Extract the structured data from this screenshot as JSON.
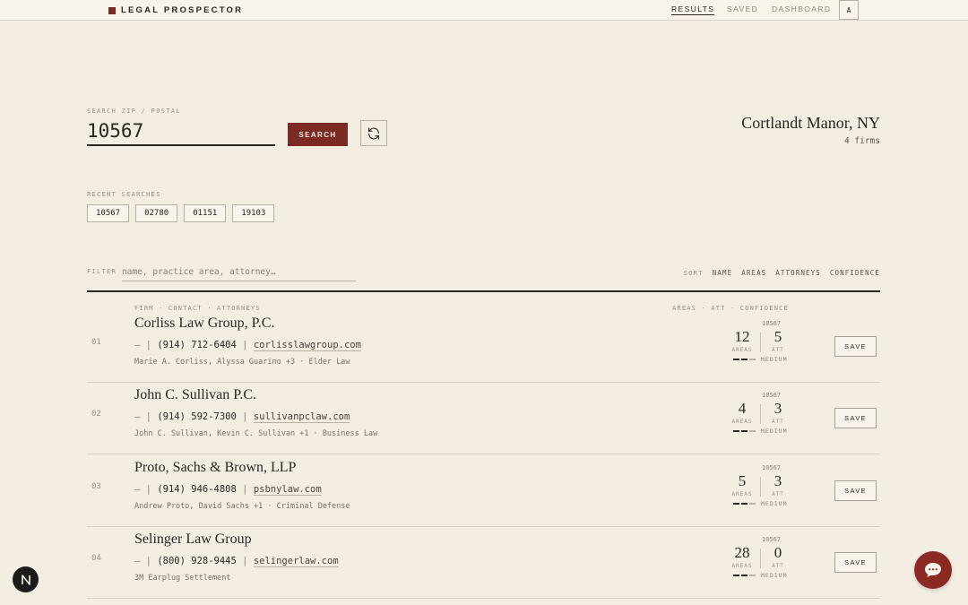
{
  "brand": {
    "name": "LEGAL PROSPECTOR",
    "accent": "#7a2a22"
  },
  "nav": [
    {
      "label": "RESULTS",
      "active": true
    },
    {
      "label": "SAVED",
      "active": false
    },
    {
      "label": "DASHBOARD",
      "active": false
    }
  ],
  "avatar": {
    "initial": "A"
  },
  "search": {
    "label": "SEARCH ZIP / POSTAL",
    "value": "10567",
    "button_label": "SEARCH",
    "refresh_icon": "refresh-icon"
  },
  "location": {
    "name": "Cortlandt Manor, NY",
    "count": "4 firms"
  },
  "recent": {
    "label": "RECENT SEARCHES",
    "items": [
      "10567",
      "02780",
      "01151",
      "19103"
    ]
  },
  "filter": {
    "label": "FILTER",
    "placeholder": "name, practice area, attorney…"
  },
  "sort": {
    "label": "SORT",
    "options": [
      "NAME",
      "AREAS",
      "ATTORNEYS",
      "CONFIDENCE"
    ]
  },
  "list_header": {
    "left": "FIRM · CONTACT · ATTORNEYS",
    "right": "AREAS · ATT · CONFIDENCE"
  },
  "firms": [
    {
      "index": "01",
      "name": "Corliss Law Group, P.C.",
      "dash": "—",
      "sep": "|",
      "phone": "(914) 712-6404",
      "website": "corlisslawgroup.com",
      "people": "Marie A. Corliss, Alyssa Guarino +3 · Elder Law",
      "zip": "10567",
      "areas": "12",
      "areas_label": "AREAS",
      "attorneys": "5",
      "att_label": "ATT",
      "confidence": "MEDIUM",
      "save_label": "SAVE"
    },
    {
      "index": "02",
      "name": "John C. Sullivan P.C.",
      "dash": "—",
      "sep": "|",
      "phone": "(914) 592-7300",
      "website": "sullivanpclaw.com",
      "people": "John C. Sullivan, Kevin C. Sullivan +1 · Business Law",
      "zip": "10567",
      "areas": "4",
      "areas_label": "AREAS",
      "attorneys": "3",
      "att_label": "ATT",
      "confidence": "MEDIUM",
      "save_label": "SAVE"
    },
    {
      "index": "03",
      "name": "Proto, Sachs & Brown, LLP",
      "dash": "—",
      "sep": "|",
      "phone": "(914) 946-4808",
      "website": "psbnylaw.com",
      "people": "Andrew Proto, David Sachs +1 · Criminal Defense",
      "zip": "10567",
      "areas": "5",
      "areas_label": "AREAS",
      "attorneys": "3",
      "att_label": "ATT",
      "confidence": "MEDIUM",
      "save_label": "SAVE"
    },
    {
      "index": "04",
      "name": "Selinger Law Group",
      "dash": "—",
      "sep": "|",
      "phone": "(800) 928-9445",
      "website": "selingerlaw.com",
      "people": "3M Earplug Settlement",
      "zip": "10567",
      "areas": "28",
      "areas_label": "AREAS",
      "attorneys": "0",
      "att_label": "ATT",
      "confidence": "MEDIUM",
      "save_label": "SAVE"
    }
  ],
  "floating": {
    "framework_badge": "N",
    "chat_icon": "chat-bubble-icon"
  }
}
